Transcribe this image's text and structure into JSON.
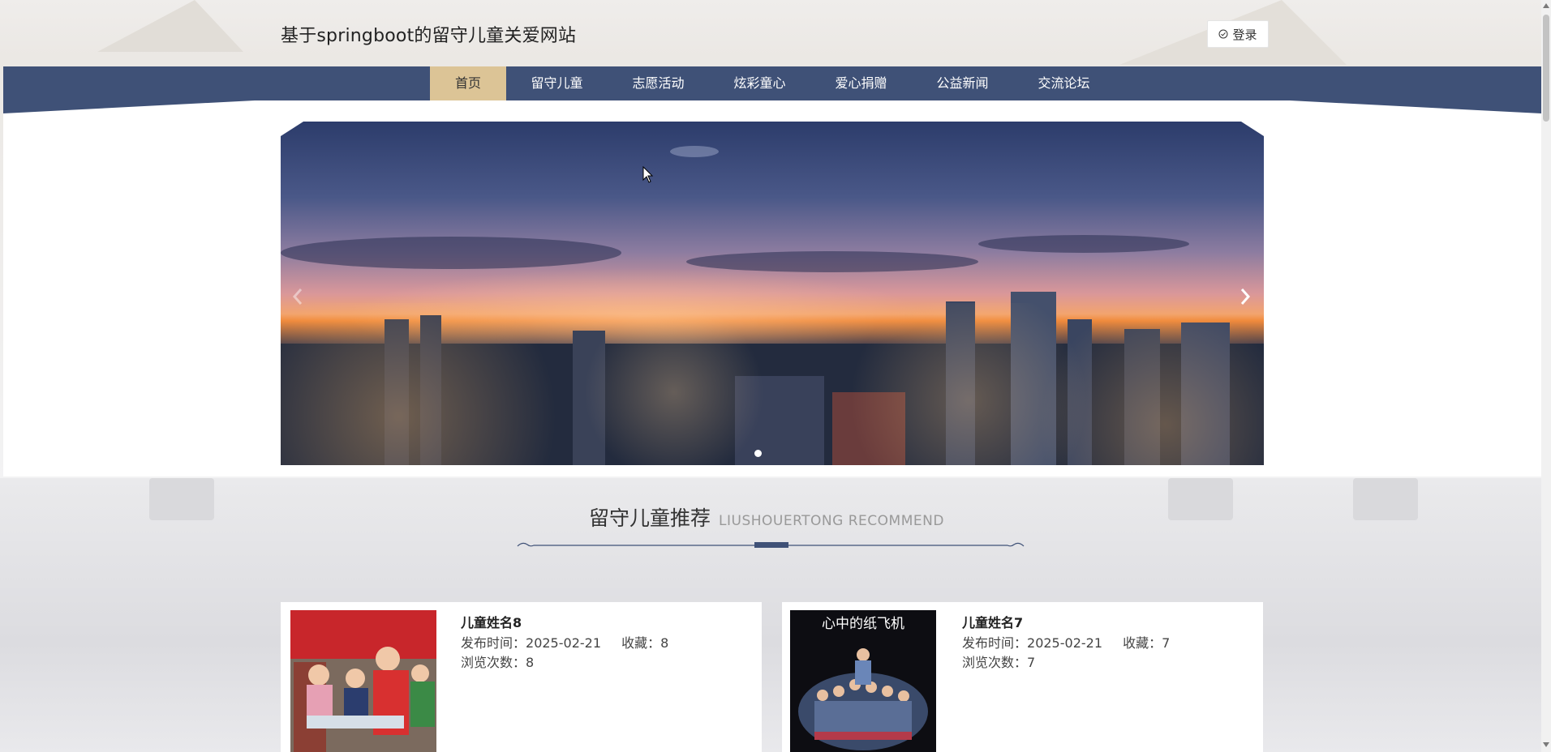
{
  "header": {
    "site_title": "基于springboot的留守儿童关爱网站",
    "login_label": "登录",
    "login_icon": "check-circle-icon"
  },
  "nav": {
    "items": [
      {
        "label": "首页",
        "active": true
      },
      {
        "label": "留守儿童",
        "active": false
      },
      {
        "label": "志愿活动",
        "active": false
      },
      {
        "label": "炫彩童心",
        "active": false
      },
      {
        "label": "爱心捐赠",
        "active": false
      },
      {
        "label": "公益新闻",
        "active": false
      },
      {
        "label": "交流论坛",
        "active": false
      }
    ]
  },
  "carousel": {
    "prev_icon": "chevron-left-icon",
    "next_icon": "chevron-right-icon",
    "slide_count": 1,
    "active_slide": 1
  },
  "section": {
    "title_zh": "留守儿童推荐",
    "title_en": "LIUSHOUERTONG RECOMMEND"
  },
  "cards": [
    {
      "name": "儿童姓名8",
      "publish_label": "发布时间：",
      "publish_date": "2025-02-21",
      "fav_label": "收藏：",
      "fav_count": "8",
      "views_label": "浏览次数：",
      "views_count": "8"
    },
    {
      "name": "儿童姓名7",
      "publish_label": "发布时间：",
      "publish_date": "2025-02-21",
      "fav_label": "收藏：",
      "fav_count": "7",
      "views_label": "浏览次数：",
      "views_count": "7",
      "image_text": "心中的纸飞机"
    }
  ],
  "colors": {
    "nav_bg": "#3f5177",
    "nav_active": "#dcc496",
    "accent": "#3f5177"
  }
}
